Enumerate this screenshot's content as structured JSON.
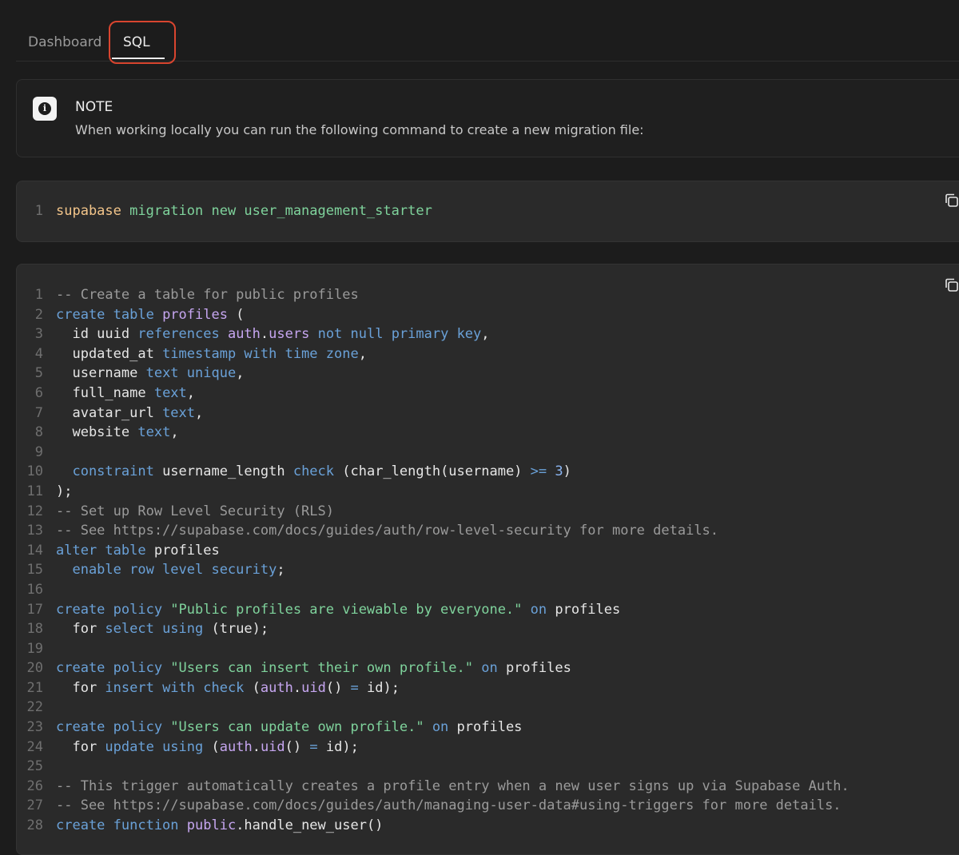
{
  "tabs": [
    {
      "label": "Dashboard",
      "active": false
    },
    {
      "label": "SQL",
      "active": true
    }
  ],
  "note": {
    "title": "NOTE",
    "body": "When working locally you can run the following command to create a new migration file:"
  },
  "command": {
    "lines": [
      [
        {
          "t": "supabase",
          "c": "cmd"
        },
        {
          "t": " migration new user_management_starter",
          "c": "str"
        }
      ]
    ]
  },
  "sql": {
    "lines": [
      [
        {
          "t": "-- Create a table for public profiles",
          "c": "comment"
        }
      ],
      [
        {
          "t": "create table ",
          "c": "kw"
        },
        {
          "t": "profiles",
          "c": "ident"
        },
        {
          "t": " (",
          "c": "plain"
        }
      ],
      [
        {
          "t": "  id uuid ",
          "c": "plain"
        },
        {
          "t": "references ",
          "c": "kw"
        },
        {
          "t": "auth",
          "c": "ident"
        },
        {
          "t": ".",
          "c": "plain"
        },
        {
          "t": "users",
          "c": "ident"
        },
        {
          "t": " not null primary key",
          "c": "kw"
        },
        {
          "t": ",",
          "c": "plain"
        }
      ],
      [
        {
          "t": "  updated_at ",
          "c": "plain"
        },
        {
          "t": "timestamp with time zone",
          "c": "kw"
        },
        {
          "t": ",",
          "c": "plain"
        }
      ],
      [
        {
          "t": "  username ",
          "c": "plain"
        },
        {
          "t": "text unique",
          "c": "kw"
        },
        {
          "t": ",",
          "c": "plain"
        }
      ],
      [
        {
          "t": "  full_name ",
          "c": "plain"
        },
        {
          "t": "text",
          "c": "kw"
        },
        {
          "t": ",",
          "c": "plain"
        }
      ],
      [
        {
          "t": "  avatar_url ",
          "c": "plain"
        },
        {
          "t": "text",
          "c": "kw"
        },
        {
          "t": ",",
          "c": "plain"
        }
      ],
      [
        {
          "t": "  website ",
          "c": "plain"
        },
        {
          "t": "text",
          "c": "kw"
        },
        {
          "t": ",",
          "c": "plain"
        }
      ],
      [],
      [
        {
          "t": "  constraint ",
          "c": "kw"
        },
        {
          "t": "username_length ",
          "c": "plain"
        },
        {
          "t": "check",
          "c": "kw"
        },
        {
          "t": " (char_length(username) ",
          "c": "plain"
        },
        {
          "t": ">=",
          "c": "kw"
        },
        {
          "t": " ",
          "c": "plain"
        },
        {
          "t": "3",
          "c": "num"
        },
        {
          "t": ")",
          "c": "plain"
        }
      ],
      [
        {
          "t": ");",
          "c": "plain"
        }
      ],
      [
        {
          "t": "-- Set up Row Level Security (RLS)",
          "c": "comment"
        }
      ],
      [
        {
          "t": "-- See https://supabase.com/docs/guides/auth/row-level-security for more details.",
          "c": "comment"
        }
      ],
      [
        {
          "t": "alter table ",
          "c": "kw"
        },
        {
          "t": "profiles",
          "c": "plain"
        }
      ],
      [
        {
          "t": "  enable row level security",
          "c": "kw"
        },
        {
          "t": ";",
          "c": "plain"
        }
      ],
      [],
      [
        {
          "t": "create policy ",
          "c": "kw"
        },
        {
          "t": "\"Public profiles are viewable by everyone.\"",
          "c": "str"
        },
        {
          "t": " on ",
          "c": "kw"
        },
        {
          "t": "profiles",
          "c": "plain"
        }
      ],
      [
        {
          "t": "  for ",
          "c": "plain"
        },
        {
          "t": "select using",
          "c": "kw"
        },
        {
          "t": " (true);",
          "c": "plain"
        }
      ],
      [],
      [
        {
          "t": "create policy ",
          "c": "kw"
        },
        {
          "t": "\"Users can insert their own profile.\"",
          "c": "str"
        },
        {
          "t": " on ",
          "c": "kw"
        },
        {
          "t": "profiles",
          "c": "plain"
        }
      ],
      [
        {
          "t": "  for ",
          "c": "plain"
        },
        {
          "t": "insert with check",
          "c": "kw"
        },
        {
          "t": " (",
          "c": "plain"
        },
        {
          "t": "auth",
          "c": "ident"
        },
        {
          "t": ".",
          "c": "plain"
        },
        {
          "t": "uid",
          "c": "ident"
        },
        {
          "t": "() ",
          "c": "plain"
        },
        {
          "t": "=",
          "c": "kw"
        },
        {
          "t": " id);",
          "c": "plain"
        }
      ],
      [],
      [
        {
          "t": "create policy ",
          "c": "kw"
        },
        {
          "t": "\"Users can update own profile.\"",
          "c": "str"
        },
        {
          "t": " on ",
          "c": "kw"
        },
        {
          "t": "profiles",
          "c": "plain"
        }
      ],
      [
        {
          "t": "  for ",
          "c": "plain"
        },
        {
          "t": "update using",
          "c": "kw"
        },
        {
          "t": " (",
          "c": "plain"
        },
        {
          "t": "auth",
          "c": "ident"
        },
        {
          "t": ".",
          "c": "plain"
        },
        {
          "t": "uid",
          "c": "ident"
        },
        {
          "t": "() ",
          "c": "plain"
        },
        {
          "t": "=",
          "c": "kw"
        },
        {
          "t": " id);",
          "c": "plain"
        }
      ],
      [],
      [
        {
          "t": "-- This trigger automatically creates a profile entry when a new user signs up via Supabase Auth.",
          "c": "comment"
        }
      ],
      [
        {
          "t": "-- See https://supabase.com/docs/guides/auth/managing-user-data#using-triggers for more details.",
          "c": "comment"
        }
      ],
      [
        {
          "t": "create function ",
          "c": "kw"
        },
        {
          "t": "public",
          "c": "ident"
        },
        {
          "t": ".handle_new_user()",
          "c": "plain"
        }
      ]
    ]
  },
  "icons": {
    "info": "info-icon",
    "copy": "copy-icon"
  }
}
